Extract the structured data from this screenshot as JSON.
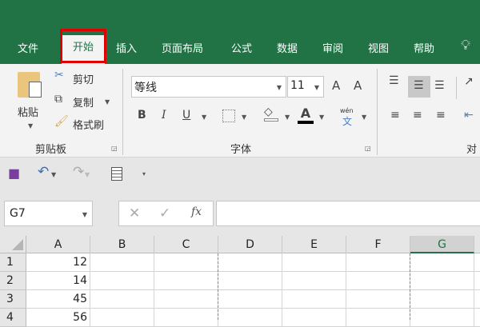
{
  "tabs": [
    "文件",
    "开始",
    "插入",
    "页面布局",
    "公式",
    "数据",
    "审阅",
    "视图",
    "帮助"
  ],
  "clipboard": {
    "paste": "粘贴",
    "cut": "剪切",
    "copy": "复制",
    "format_painter": "格式刷",
    "group": "剪贴板"
  },
  "font": {
    "name": "等线",
    "size": "11",
    "group": "字体",
    "phonetic": "wén",
    "phonetic_char": "文",
    "bold": "B",
    "italic": "I",
    "underline": "U",
    "font_color": "A",
    "grow": "A",
    "shrink": "A"
  },
  "alignment": {
    "group": "对齐"
  },
  "formula_bar": {
    "name_box": "G7",
    "fx": "fx",
    "value": ""
  },
  "columns": [
    "A",
    "B",
    "C",
    "D",
    "E",
    "F",
    "G"
  ],
  "rows": [
    {
      "n": "1",
      "a": "12"
    },
    {
      "n": "2",
      "a": "14"
    },
    {
      "n": "3",
      "a": "45"
    },
    {
      "n": "4",
      "a": "56"
    }
  ],
  "colors": {
    "brand": "#217346",
    "highlight": "#e00000"
  }
}
